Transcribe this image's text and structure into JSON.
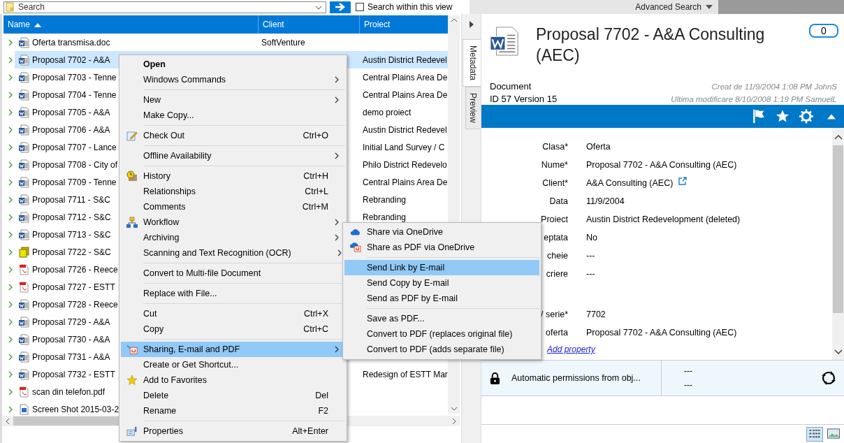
{
  "search_bar": {
    "placeholder": "Search",
    "within_view": {
      "label": "Search within this view",
      "checked": false
    },
    "advanced": "Advanced Search"
  },
  "list": {
    "columns": [
      "Name",
      "Client",
      "Proiect"
    ],
    "rows": [
      {
        "name": "Oferta transmisa.doc",
        "client": "SoftVenture",
        "kind": "word",
        "selected": false
      },
      {
        "name": "Proposal 7702 - A&A",
        "project": "Austin District Redevel",
        "kind": "word",
        "selected": true
      },
      {
        "name": "Proposal 7703 - Tenne",
        "project": "Central Plains Area De",
        "kind": "word",
        "selected": false
      },
      {
        "name": "Proposal 7704 - Tenne",
        "project": "Central Plains Area De",
        "kind": "word",
        "selected": false
      },
      {
        "name": "Proposal 7705 - A&A",
        "project": "demo proiect",
        "kind": "word",
        "selected": false
      },
      {
        "name": "Proposal 7706 - A&A",
        "project": "Austin District Redevel",
        "kind": "word",
        "selected": false
      },
      {
        "name": "Proposal 7707 - Lance",
        "project": "Initial Land Survey / C",
        "kind": "word",
        "selected": false
      },
      {
        "name": "Proposal 7708 - City of",
        "project": "Philo District Redevelo",
        "kind": "word",
        "selected": false
      },
      {
        "name": "Proposal 7709 - Tenne",
        "project": "Central Plains Area De",
        "kind": "word",
        "selected": false
      },
      {
        "name": "Proposal 7711 - S&C",
        "project": "Rebranding",
        "kind": "word",
        "selected": false
      },
      {
        "name": "Proposal 7712 - S&C",
        "project": "Rebranding",
        "kind": "word",
        "selected": false
      },
      {
        "name": "Proposal 7713 - S&C",
        "kind": "word",
        "selected": false
      },
      {
        "name": "Proposal 7722 - S&C",
        "kind": "multi",
        "selected": false
      },
      {
        "name": "Proposal 7726 - Reece",
        "kind": "pdf",
        "selected": false
      },
      {
        "name": "Proposal 7727 - ESTT",
        "kind": "pdf",
        "selected": false
      },
      {
        "name": "Proposal 7728 - Reece",
        "kind": "word",
        "selected": false
      },
      {
        "name": "Proposal 7729 - A&A",
        "kind": "word",
        "selected": false
      },
      {
        "name": "Proposal 7730 - A&A",
        "kind": "word",
        "selected": false
      },
      {
        "name": "Proposal 7731 - A&A",
        "kind": "word",
        "selected": false
      },
      {
        "name": "Proposal 7732 - ESTT",
        "project": "Redesign of ESTT Mar",
        "kind": "word",
        "selected": false
      },
      {
        "name": "scan din telefon.pdf",
        "kind": "pdf",
        "selected": false
      },
      {
        "name": "Screen Shot 2015-03-2",
        "kind": "image",
        "selected": false
      }
    ]
  },
  "context_menu": [
    {
      "kind": "item",
      "label": "Open",
      "default": true,
      "submenu": false,
      "selected": false
    },
    {
      "kind": "item",
      "label": "Windows Commands",
      "default": false,
      "submenu": true,
      "selected": false
    },
    {
      "kind": "separator"
    },
    {
      "kind": "item",
      "label": "New",
      "default": false,
      "submenu": true,
      "selected": false
    },
    {
      "kind": "item",
      "label": "Make Copy...",
      "default": false,
      "submenu": false,
      "selected": false
    },
    {
      "kind": "separator"
    },
    {
      "kind": "item",
      "label": "Check Out",
      "default": false,
      "shortcut": "Ctrl+O",
      "submenu": false,
      "selected": false
    },
    {
      "kind": "separator"
    },
    {
      "kind": "item",
      "label": "Offline Availability",
      "default": false,
      "submenu": true,
      "selected": false
    },
    {
      "kind": "separator"
    },
    {
      "kind": "item",
      "label": "History",
      "default": false,
      "shortcut": "Ctrl+H",
      "submenu": false,
      "selected": false
    },
    {
      "kind": "item",
      "label": "Relationships",
      "default": false,
      "shortcut": "Ctrl+L",
      "submenu": false,
      "selected": false
    },
    {
      "kind": "item",
      "label": "Comments",
      "default": false,
      "shortcut": "Ctrl+M",
      "submenu": false,
      "selected": false
    },
    {
      "kind": "item",
      "label": "Workflow",
      "default": false,
      "submenu": true,
      "selected": false
    },
    {
      "kind": "item",
      "label": "Archiving",
      "default": false,
      "submenu": true,
      "selected": false
    },
    {
      "kind": "item",
      "label": "Scanning and Text Recognition (OCR)",
      "default": false,
      "submenu": true,
      "selected": false
    },
    {
      "kind": "separator"
    },
    {
      "kind": "item",
      "label": "Convert to Multi-file Document",
      "default": false,
      "submenu": false,
      "selected": false
    },
    {
      "kind": "separator"
    },
    {
      "kind": "item",
      "label": "Replace with File...",
      "default": false,
      "submenu": false,
      "selected": false
    },
    {
      "kind": "separator"
    },
    {
      "kind": "item",
      "label": "Cut",
      "default": false,
      "shortcut": "Ctrl+X",
      "submenu": false,
      "selected": false
    },
    {
      "kind": "item",
      "label": "Copy",
      "default": false,
      "shortcut": "Ctrl+C",
      "submenu": false,
      "selected": false
    },
    {
      "kind": "separator"
    },
    {
      "kind": "item",
      "label": "Sharing, E-mail and PDF",
      "default": false,
      "submenu": true,
      "selected": true
    },
    {
      "kind": "item",
      "label": "Create or Get Shortcut...",
      "default": false,
      "submenu": false,
      "selected": false
    },
    {
      "kind": "item",
      "label": "Add to Favorites",
      "default": false,
      "submenu": false,
      "selected": false
    },
    {
      "kind": "item",
      "label": "Delete",
      "default": false,
      "shortcut": "Del",
      "submenu": false,
      "selected": false
    },
    {
      "kind": "item",
      "label": "Rename",
      "default": false,
      "shortcut": "F2",
      "submenu": false,
      "selected": false
    },
    {
      "kind": "separator"
    },
    {
      "kind": "item",
      "label": "Properties",
      "default": false,
      "shortcut": "Alt+Enter",
      "submenu": false,
      "selected": false
    }
  ],
  "submenu": [
    {
      "kind": "item",
      "label": "Share via OneDrive",
      "selected": false
    },
    {
      "kind": "item",
      "label": "Share as PDF via OneDrive",
      "selected": false
    },
    {
      "kind": "separator"
    },
    {
      "kind": "item",
      "label": "Send Link by E-mail",
      "selected": true
    },
    {
      "kind": "item",
      "label": "Send Copy by E-mail",
      "selected": false
    },
    {
      "kind": "item",
      "label": "Send as PDF by E-mail",
      "selected": false
    },
    {
      "kind": "separator"
    },
    {
      "kind": "item",
      "label": "Save as PDF...",
      "selected": false
    },
    {
      "kind": "item",
      "label": "Convert to PDF (replaces original file)",
      "selected": false
    },
    {
      "kind": "item",
      "label": "Convert to PDF (adds separate file)",
      "selected": false
    }
  ],
  "side_tabs": [
    {
      "label": "Metadata",
      "selected": true
    },
    {
      "label": "Preview",
      "selected": false
    }
  ],
  "details": {
    "title": "Proposal 7702 - A&A Consulting (AEC)",
    "comments": "0",
    "type": "Document",
    "id_version": "ID 57  Version 15",
    "created": "Creat de 11/9/2004 1:08 PM JohnS",
    "modified": "Ultima modificare 8/10/2008 1:19 PM SamuelL",
    "property_groups": [
      [
        {
          "label": "Clasa*",
          "value": "Oferta",
          "link": false
        },
        {
          "label": "Nume*",
          "value": "Proposal 7702 - A&A Consulting (AEC)",
          "link": false
        },
        {
          "label": "Client*",
          "value": "A&A Consulting (AEC)",
          "link": true
        },
        {
          "label": "Data",
          "value": "11/9/2004",
          "link": false
        },
        {
          "label": "Proiect",
          "value": "Austin District Redevelopment (deleted)",
          "link": false
        },
        {
          "label": "eptata",
          "value": "No",
          "link": false
        },
        {
          "label": "cheie",
          "value": "---",
          "link": false
        },
        {
          "label": "criere",
          "value": "---",
          "link": false
        }
      ],
      [
        {
          "label": "/ serie*",
          "value": "7702",
          "link": false
        },
        {
          "label": "oferta",
          "value": "Proposal 7702 - A&A Consulting (AEC)",
          "link": false
        }
      ]
    ],
    "add_property": "Add property",
    "permissions": {
      "text": "Automatic permissions from obj...",
      "line_1": "---",
      "line_2": "---"
    }
  }
}
